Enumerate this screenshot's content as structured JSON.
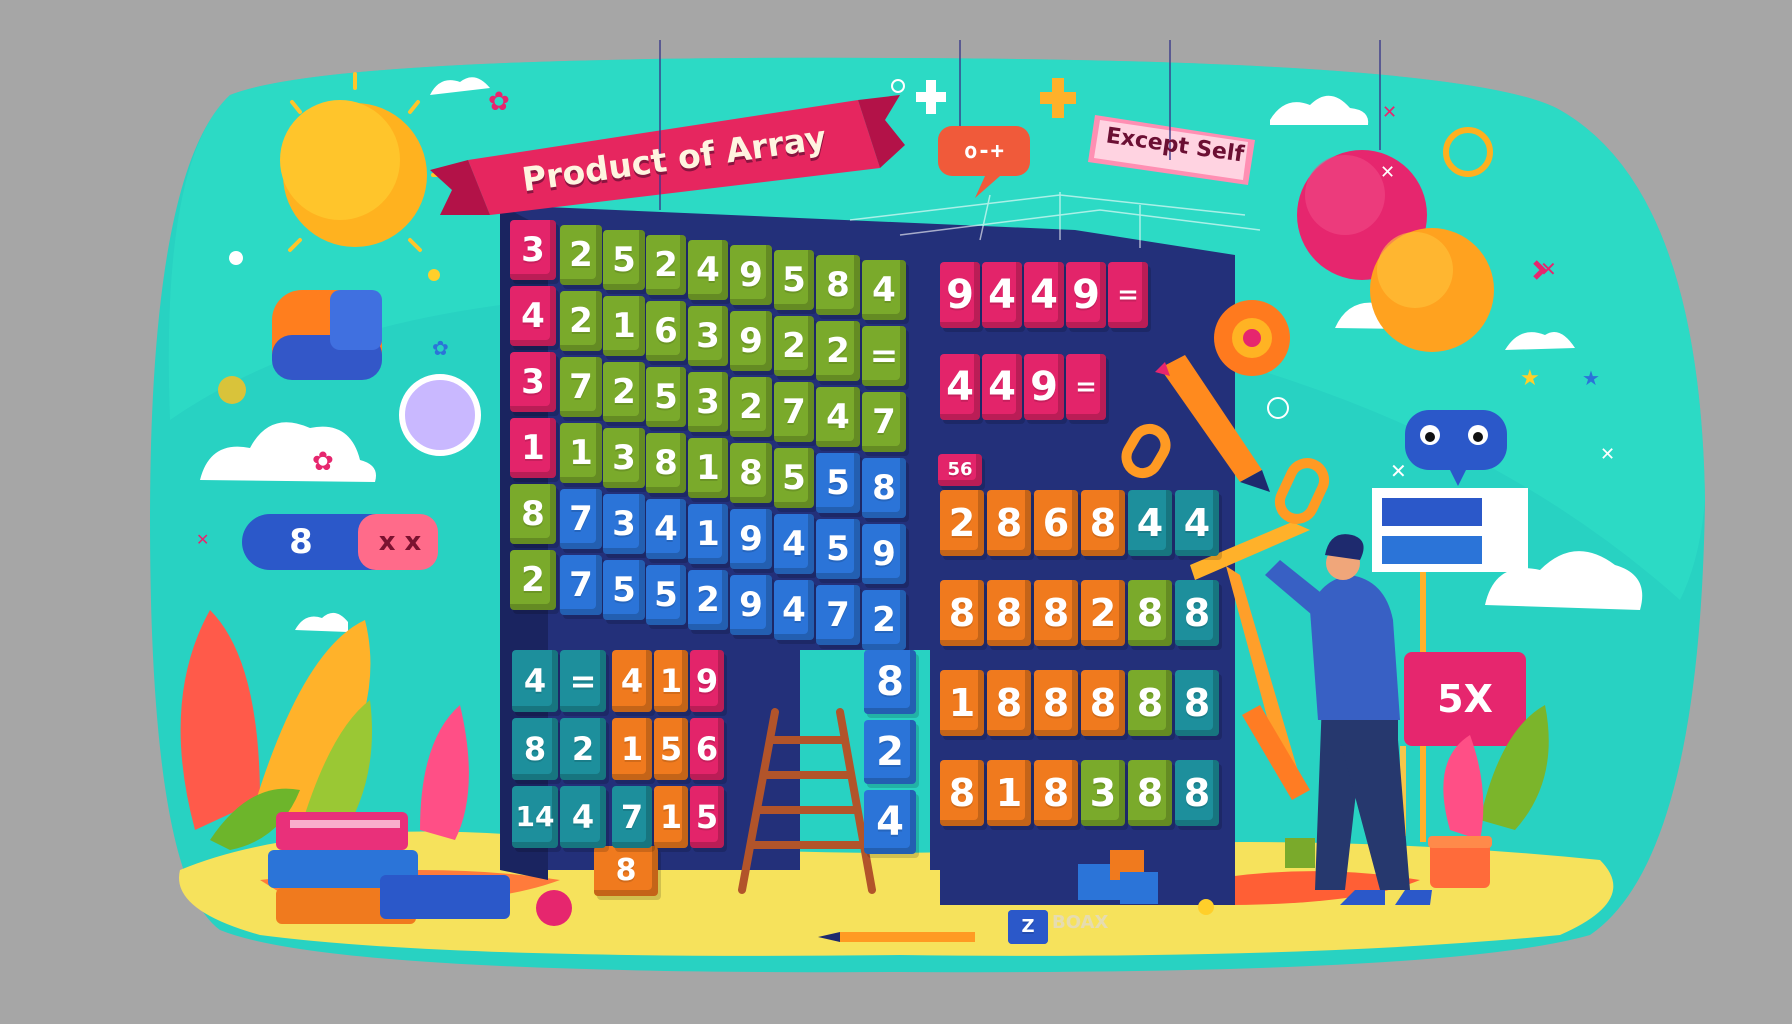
{
  "title_banner": "Product of Array",
  "subtitle_tag": "Except Self",
  "pill": {
    "number": "8",
    "symbols": "x x"
  },
  "sign": "5X",
  "speech_bubble": "o-+",
  "small_block_label": "8",
  "ground_cube_label": "Z",
  "ground_scribble": "BOAX",
  "colors": {
    "background": "#a6a6a6",
    "scene": "#27d3c0",
    "navy": "#22307a",
    "pink": "#e3246a",
    "green": "#7aaa2b",
    "blue": "#2b74d8",
    "orange": "#f07a1e",
    "teal": "#1d8f9c"
  },
  "left_grid": {
    "columns": [
      {
        "color": "pink",
        "cells": [
          "3",
          "4",
          "3",
          "1",
          "8",
          "2"
        ]
      },
      {
        "color": "green",
        "cells": [
          "2",
          "2",
          "7",
          "1",
          "7",
          "7"
        ]
      },
      {
        "color": "green",
        "cells": [
          "5",
          "1",
          "2",
          "3",
          "3",
          "5"
        ]
      },
      {
        "color": "green",
        "cells": [
          "2",
          "6",
          "5",
          "8",
          "4",
          "5"
        ]
      },
      {
        "color": "green",
        "cells": [
          "4",
          "3",
          "3",
          "1",
          "1",
          "2"
        ]
      },
      {
        "color": "green",
        "cells": [
          "9",
          "9",
          "2",
          "8",
          "9",
          "9"
        ]
      },
      {
        "color": "green",
        "cells": [
          "5",
          "2",
          "7",
          "5",
          "4",
          "4"
        ]
      },
      {
        "color": "green",
        "cells": [
          "8",
          "2",
          "4",
          "5",
          "5",
          "7"
        ]
      },
      {
        "color": "green",
        "cells": [
          "4",
          "=",
          "7",
          "8",
          "9",
          "2"
        ]
      }
    ],
    "lower_rows": [
      {
        "cells": [
          "4",
          "=",
          "4",
          "1",
          "9"
        ]
      },
      {
        "cells": [
          "8",
          "2",
          "1",
          "5",
          "6"
        ]
      },
      {
        "cells": [
          "14",
          "4",
          "7",
          "1",
          "5"
        ]
      }
    ],
    "tall_column": [
      "8",
      "2",
      "4"
    ]
  },
  "right_grid": {
    "top_rows": [
      {
        "color": "pink",
        "cells": [
          "9",
          "4",
          "4",
          "9",
          "="
        ]
      },
      {
        "color": "pink",
        "cells": [
          "4",
          "4",
          "9",
          "="
        ]
      }
    ],
    "small_tag": "56",
    "rows": [
      {
        "cells": [
          "2",
          "8",
          "6",
          "8",
          "4",
          "4"
        ]
      },
      {
        "cells": [
          "8",
          "8",
          "8",
          "2",
          "8",
          "8"
        ]
      },
      {
        "cells": [
          "1",
          "8",
          "8",
          "8",
          "8",
          "8"
        ]
      },
      {
        "cells": [
          "8",
          "1",
          "8",
          "3",
          "8",
          "8"
        ]
      }
    ]
  }
}
